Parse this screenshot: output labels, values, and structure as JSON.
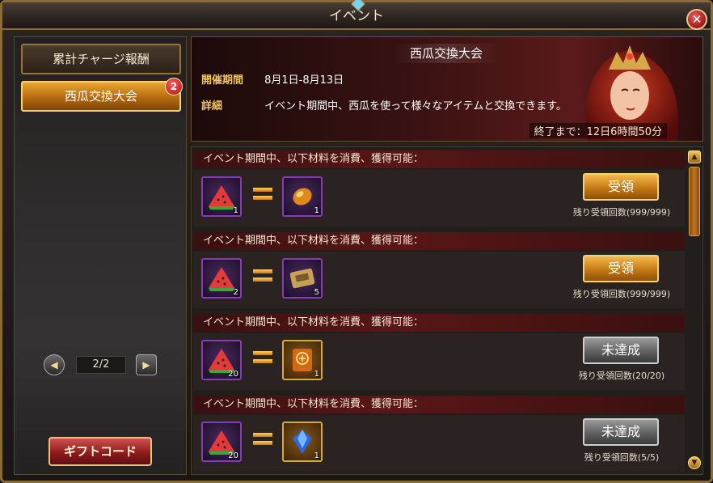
{
  "window": {
    "title": "イベント"
  },
  "sidebar": {
    "items": [
      {
        "label": "累計チャージ報酬"
      },
      {
        "label": "西瓜交換大会",
        "badge": "2"
      }
    ],
    "pager": {
      "page": "2/2"
    },
    "gift_label": "ギフトコード"
  },
  "event": {
    "title": "西瓜交換大会",
    "period_label": "開催期間",
    "period_value": "8月1日-8月13日",
    "detail_label": "詳細",
    "detail_value": "イベント期間中、西瓜を使って様々なアイテムと交換できます。",
    "countdown": "終了まで：12日6時間50分"
  },
  "exchanges": [
    {
      "header": "イベント期間中、以下材料を消費、獲得可能：",
      "cost_qty": "1",
      "reward_icon": "orange-gem-icon",
      "reward_qty": "1",
      "button": "受領",
      "button_state": "available",
      "remaining": "残り受領回数(999/999)"
    },
    {
      "header": "イベント期間中、以下材料を消費、獲得可能：",
      "cost_qty": "2",
      "reward_icon": "exp-scroll-icon",
      "reward_qty": "5",
      "button": "受領",
      "button_state": "available",
      "remaining": "残り受領回数(999/999)"
    },
    {
      "header": "イベント期間中、以下材料を消費、獲得可能：",
      "cost_qty": "20",
      "reward_icon": "rune-book-icon",
      "reward_qty": "1",
      "button": "未達成",
      "button_state": "unavailable",
      "remaining": "残り受領回数(20/20)"
    },
    {
      "header": "イベント期間中、以下材料を消費、獲得可能：",
      "cost_qty": "20",
      "reward_icon": "blue-crystal-icon",
      "reward_qty": "1",
      "button": "未達成",
      "button_state": "unavailable",
      "remaining": "残り受領回数(5/5)"
    }
  ]
}
